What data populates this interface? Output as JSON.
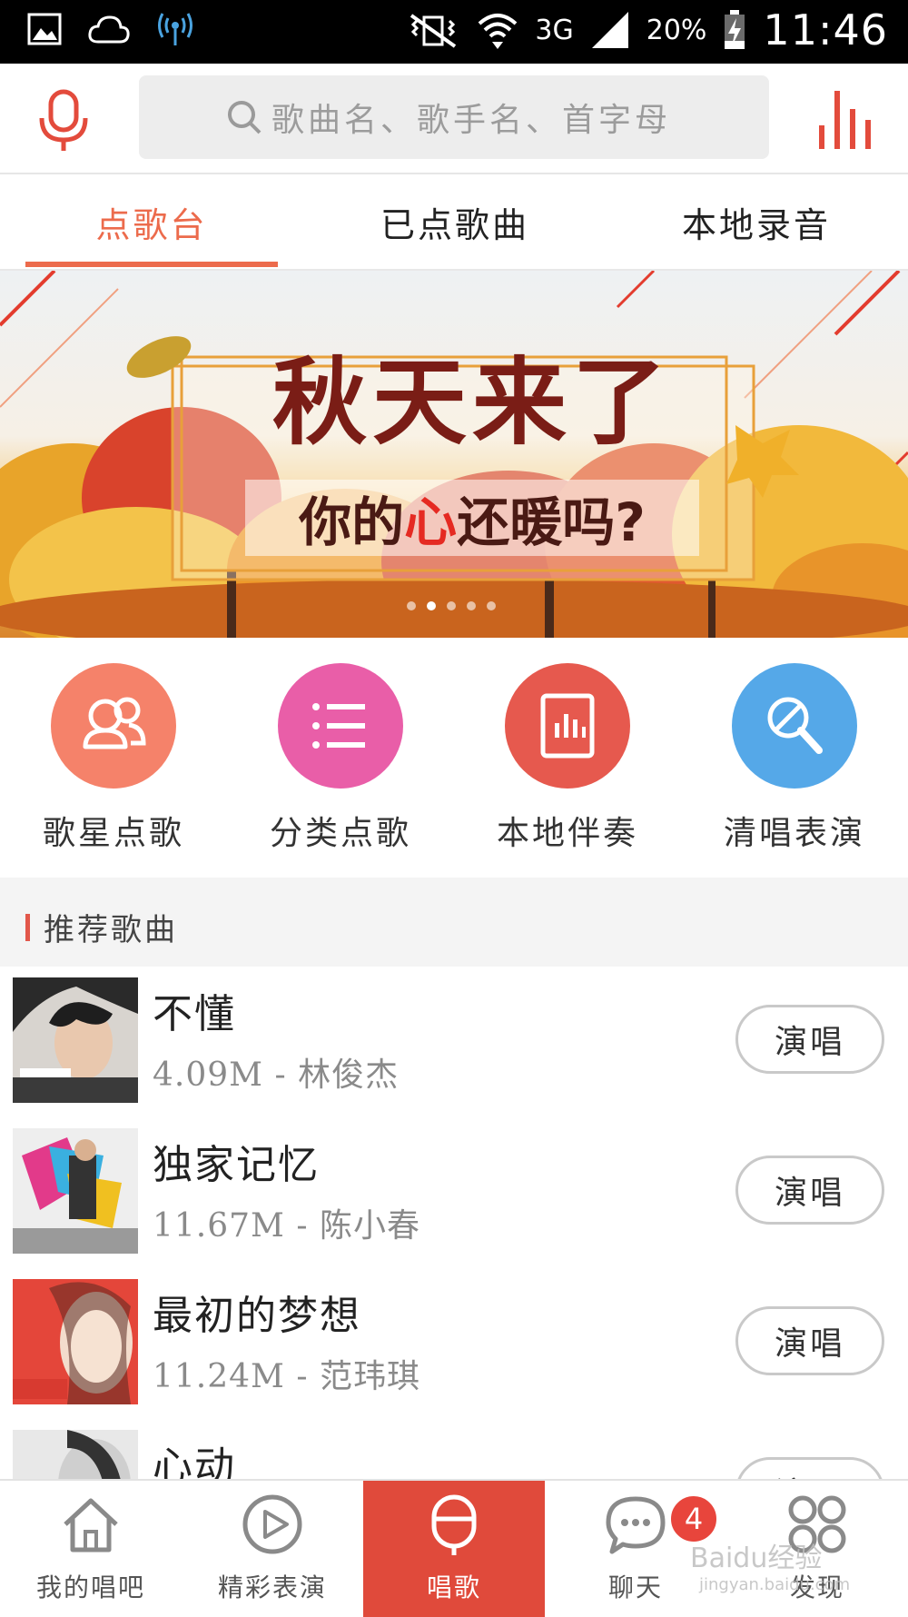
{
  "status_bar": {
    "network": "3G",
    "battery": "20%",
    "time": "11:46"
  },
  "header": {
    "search_placeholder": "歌曲名、歌手名、首字母",
    "accent_color": "#ec6b4c"
  },
  "tabs": [
    {
      "label": "点歌台",
      "active": true
    },
    {
      "label": "已点歌曲",
      "active": false
    },
    {
      "label": "本地录音",
      "active": false
    }
  ],
  "banner": {
    "title": "秋天来了",
    "subtitle_before": "你的",
    "subtitle_highlight": "心",
    "subtitle_after": "还暖吗?",
    "page_count": 5,
    "current_page": 2
  },
  "quick_actions": [
    {
      "label": "歌星点歌",
      "icon": "singers-icon",
      "color": "#f5826a"
    },
    {
      "label": "分类点歌",
      "icon": "list-icon",
      "color": "#e95ea8"
    },
    {
      "label": "本地伴奏",
      "icon": "audio-file-icon",
      "color": "#e6594e"
    },
    {
      "label": "清唱表演",
      "icon": "microphone-icon",
      "color": "#55a8e8"
    }
  ],
  "section": {
    "title": "推荐歌曲"
  },
  "songs": [
    {
      "title": "不懂",
      "meta": "4.09M - 林俊杰",
      "action": "演唱"
    },
    {
      "title": "独家记忆",
      "meta": "11.67M - 陈小春",
      "action": "演唱"
    },
    {
      "title": "最初的梦想",
      "meta": "11.24M - 范玮琪",
      "action": "演唱"
    },
    {
      "title": "心动",
      "meta": "",
      "action": "演唱"
    }
  ],
  "bottom_nav": [
    {
      "label": "我的唱吧",
      "icon": "home-icon"
    },
    {
      "label": "精彩表演",
      "icon": "play-icon"
    },
    {
      "label": "唱歌",
      "icon": "microphone-icon",
      "active": true
    },
    {
      "label": "聊天",
      "icon": "chat-icon",
      "badge": "4"
    },
    {
      "label": "发现",
      "icon": "discover-icon"
    }
  ],
  "watermark": {
    "brand": "Baidu经验",
    "url": "jingyan.baidu.com"
  }
}
